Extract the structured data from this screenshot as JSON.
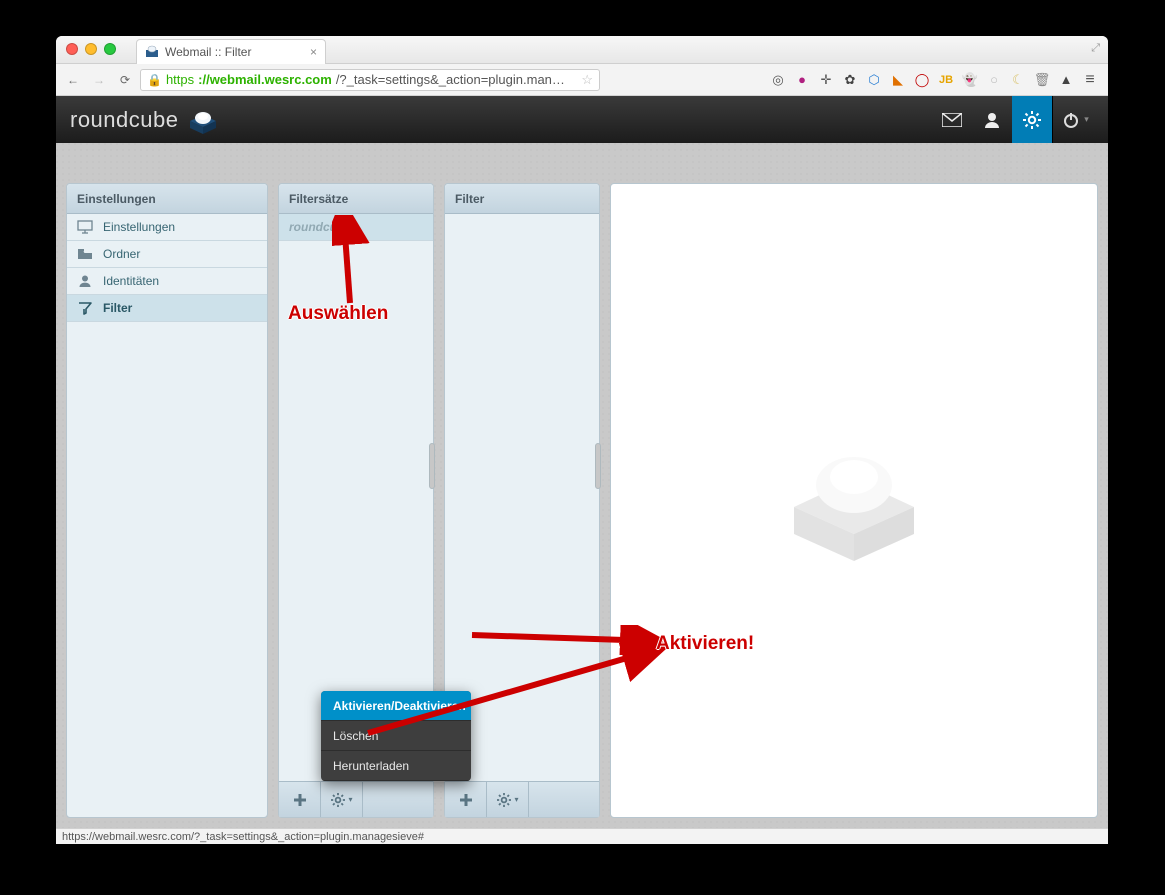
{
  "window": {
    "tab_title": "Webmail :: Filter",
    "url_scheme": "https",
    "url_host": "://webmail.wesrc.com",
    "url_path": "/?_task=settings&_action=plugin.man…",
    "status_text": "https://webmail.wesrc.com/?_task=settings&_action=plugin.managesieve#"
  },
  "header": {
    "logo_text": "roundcube",
    "tools": {
      "mail": "mail-icon",
      "contacts": "person-icon",
      "settings": "gear-icon",
      "logout": "power-icon"
    }
  },
  "sidebar": {
    "title": "Einstellungen",
    "items": [
      {
        "label": "Einstellungen",
        "icon": "monitor-icon"
      },
      {
        "label": "Ordner",
        "icon": "folder-icon"
      },
      {
        "label": "Identitäten",
        "icon": "person-icon"
      },
      {
        "label": "Filter",
        "icon": "filter-icon"
      }
    ],
    "selected_index": 3
  },
  "filtersets": {
    "title": "Filtersätze",
    "items": [
      {
        "label": "roundcube",
        "selected": true
      }
    ],
    "popup": {
      "items": [
        {
          "label": "Aktivieren/Deaktivieren",
          "highlighted": true
        },
        {
          "label": "Löschen"
        },
        {
          "label": "Herunterladen"
        }
      ]
    }
  },
  "filters": {
    "title": "Filter",
    "items": []
  },
  "annotations": {
    "select_label": "Auswählen",
    "activate_label": "Aktivieren!"
  },
  "ext_icons": [
    "◎",
    "●",
    "✛",
    "✿",
    "⬡",
    "◣",
    "◯",
    "JB",
    "👻",
    "○",
    "☾",
    "🗑",
    "▲",
    "≡"
  ]
}
